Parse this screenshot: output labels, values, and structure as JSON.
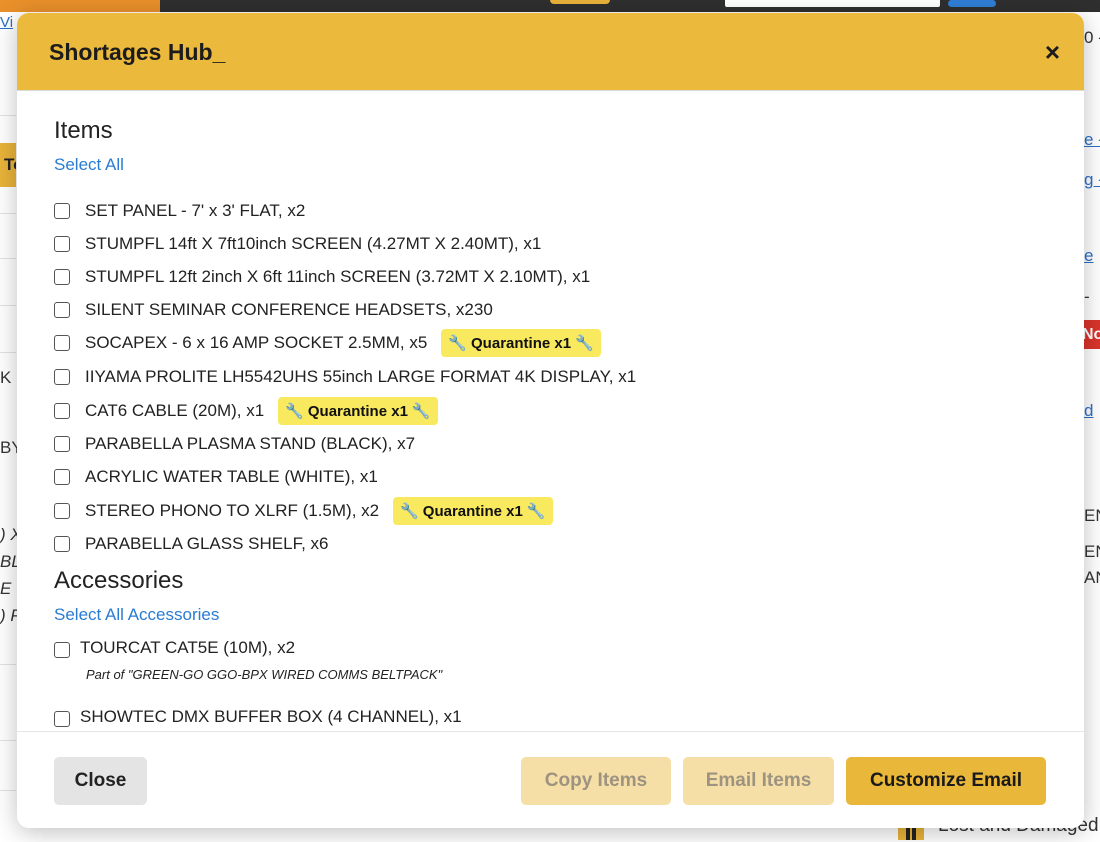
{
  "background": {
    "fragments": [
      "Vi",
      "0 -",
      "e -",
      "g -",
      "e",
      "-",
      "K",
      "d",
      "BY",
      ") X",
      "BL",
      "E -",
      ") P",
      "EN",
      "EN",
      "AN"
    ],
    "left_tag": "To",
    "red_badge": "No",
    "bottom_text": "Lost and Damaged"
  },
  "modal": {
    "title": "Shortages Hub",
    "title_cursor": "_",
    "close_glyph": "×",
    "items_section": {
      "heading": "Items",
      "select_all": "Select All",
      "items": [
        {
          "label": "SET PANEL - 7' x 3' FLAT, x2"
        },
        {
          "label": "STUMPFL 14ft X 7ft10inch SCREEN (4.27MT X 2.40MT), x1"
        },
        {
          "label": "STUMPFL 12ft 2inch X 6ft 11inch SCREEN (3.72MT X 2.10MT), x1"
        },
        {
          "label": "SILENT SEMINAR CONFERENCE HEADSETS, x230"
        },
        {
          "label": "SOCAPEX - 6 x 16 AMP SOCKET 2.5MM, x5",
          "badge": "Quarantine x1"
        },
        {
          "label": "IIYAMA PROLITE LH5542UHS 55inch LARGE FORMAT 4K DISPLAY, x1"
        },
        {
          "label": "CAT6 CABLE (20M), x1",
          "badge": "Quarantine x1"
        },
        {
          "label": "PARABELLA PLASMA STAND (BLACK), x7"
        },
        {
          "label": "ACRYLIC WATER TABLE (WHITE), x1"
        },
        {
          "label": "STEREO PHONO TO XLRF (1.5M), x2",
          "badge": "Quarantine x1"
        },
        {
          "label": "PARABELLA GLASS SHELF, x6"
        }
      ]
    },
    "accessories_section": {
      "heading": "Accessories",
      "select_all": "Select All Accessories",
      "items": [
        {
          "label": "TOURCAT CAT5E (10M), x2",
          "sub": "Part of \"GREEN-GO GGO-BPX WIRED COMMS BELTPACK\""
        },
        {
          "label": "SHOWTEC DMX BUFFER BOX (4 CHANNEL), x1"
        }
      ]
    },
    "footer": {
      "close": "Close",
      "copy": "Copy Items",
      "email": "Email Items",
      "customize": "Customize Email"
    }
  },
  "colors": {
    "header": "#ebb93b",
    "badge": "#f9e95f",
    "primary_button": "#e9b73a",
    "disabled_button": "#f5dfa6",
    "link": "#2a7bd3"
  }
}
